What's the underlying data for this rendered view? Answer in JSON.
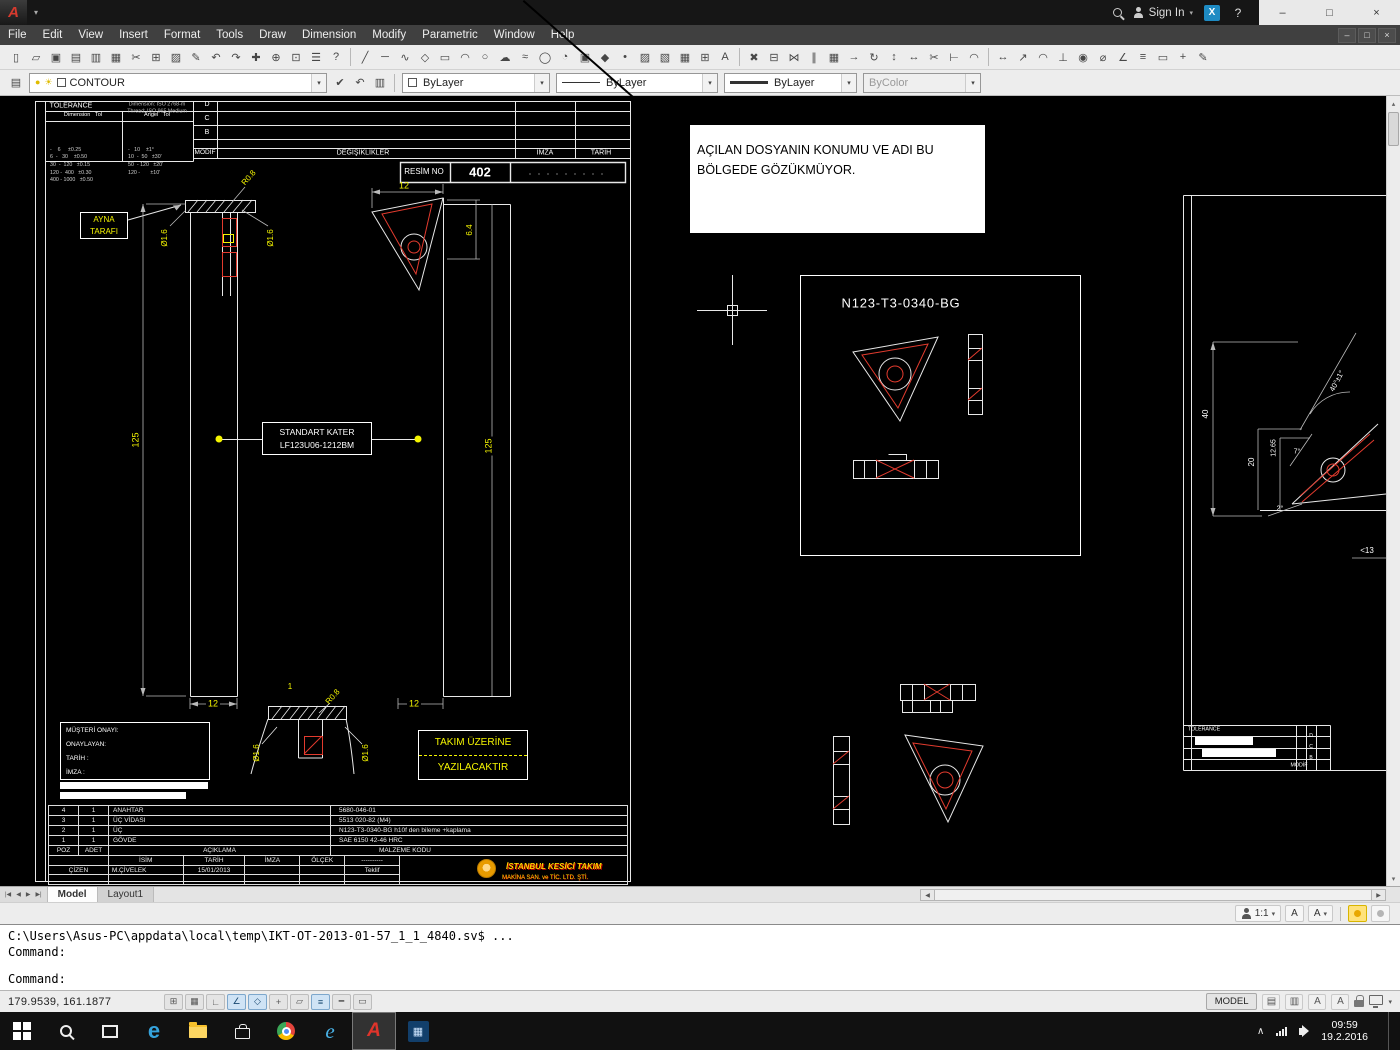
{
  "titlebar": {
    "sign_in": "Sign In",
    "menus": [
      "File",
      "Edit",
      "View",
      "Insert",
      "Format",
      "Tools",
      "Draw",
      "Dimension",
      "Modify",
      "Parametric",
      "Window",
      "Help"
    ]
  },
  "icons": {
    "minimize": "–",
    "maximize": "□",
    "close": "×",
    "caret_down": "▾",
    "caret_up": "▴",
    "chevron_up": "∧",
    "left": "◀",
    "right": "▶",
    "first": "|◀",
    "last": "▶|",
    "help": "?",
    "exchange": "X"
  },
  "toolbars": {
    "standard": [
      {
        "name": "qnew-icon",
        "g": "▯"
      },
      {
        "name": "open-icon",
        "g": "▱"
      },
      {
        "name": "save-icon",
        "g": "▣"
      },
      {
        "name": "plot-icon",
        "g": "▤"
      },
      {
        "name": "plot-preview-icon",
        "g": "▥"
      },
      {
        "name": "publish-icon",
        "g": "▦"
      },
      {
        "name": "cut-icon",
        "g": "✂"
      },
      {
        "name": "copy-icon",
        "g": "⊞"
      },
      {
        "name": "paste-icon",
        "g": "▨"
      },
      {
        "name": "match-properties-icon",
        "g": "✎"
      },
      {
        "name": "undo-icon",
        "g": "↶"
      },
      {
        "name": "redo-icon",
        "g": "↷"
      },
      {
        "name": "pan-icon",
        "g": "✚"
      },
      {
        "name": "zoom-realtime-icon",
        "g": "⊕"
      },
      {
        "name": "zoom-window-icon",
        "g": "⊡"
      },
      {
        "name": "properties-icon",
        "g": "☰"
      },
      {
        "name": "help-icon",
        "g": "?"
      }
    ],
    "draw": [
      {
        "name": "line-icon",
        "g": "╱"
      },
      {
        "name": "construction-line-icon",
        "g": "─"
      },
      {
        "name": "polyline-icon",
        "g": "∿"
      },
      {
        "name": "polygon-icon",
        "g": "◇"
      },
      {
        "name": "rectangle-icon",
        "g": "▭"
      },
      {
        "name": "arc-icon",
        "g": "◠"
      },
      {
        "name": "circle-icon",
        "g": "○"
      },
      {
        "name": "revcloud-icon",
        "g": "☁"
      },
      {
        "name": "spline-icon",
        "g": "≈"
      },
      {
        "name": "ellipse-icon",
        "g": "◯"
      },
      {
        "name": "ellipse-arc-icon",
        "g": "◔"
      },
      {
        "name": "insert-block-icon",
        "g": "▣"
      },
      {
        "name": "make-block-icon",
        "g": "◆"
      },
      {
        "name": "point-icon",
        "g": "•"
      },
      {
        "name": "hatch-icon",
        "g": "▨"
      },
      {
        "name": "gradient-icon",
        "g": "▧"
      },
      {
        "name": "region-icon",
        "g": "▦"
      },
      {
        "name": "table-icon",
        "g": "⊞"
      },
      {
        "name": "mtext-icon",
        "g": "A"
      }
    ],
    "modify": [
      {
        "name": "erase-icon",
        "g": "✖"
      },
      {
        "name": "copy-object-icon",
        "g": "⊟"
      },
      {
        "name": "mirror-icon",
        "g": "⋈"
      },
      {
        "name": "offset-icon",
        "g": "∥"
      },
      {
        "name": "array-icon",
        "g": "▦"
      },
      {
        "name": "move-icon",
        "g": "→"
      },
      {
        "name": "rotate-icon",
        "g": "↻"
      },
      {
        "name": "scale-icon",
        "g": "↕"
      },
      {
        "name": "stretch-icon",
        "g": "↔"
      },
      {
        "name": "trim-icon",
        "g": "✂"
      },
      {
        "name": "extend-icon",
        "g": "⊢"
      },
      {
        "name": "fillet-icon",
        "g": "◠"
      }
    ],
    "dimension": [
      {
        "name": "dim-linear-icon",
        "g": "↔"
      },
      {
        "name": "dim-aligned-icon",
        "g": "↗"
      },
      {
        "name": "dim-arc-icon",
        "g": "◠"
      },
      {
        "name": "dim-ordinate-icon",
        "g": "⊥"
      },
      {
        "name": "dim-radius-icon",
        "g": "◉"
      },
      {
        "name": "dim-diameter-icon",
        "g": "⌀"
      },
      {
        "name": "dim-angular-icon",
        "g": "∠"
      },
      {
        "name": "dim-quick-icon",
        "g": "≡"
      },
      {
        "name": "dim-baseline-icon",
        "g": "▭"
      },
      {
        "name": "dim-continue-icon",
        "g": "+"
      },
      {
        "name": "dim-style-icon",
        "g": "✎"
      }
    ]
  },
  "layers": {
    "current": "CONTOUR",
    "color": "ByLayer",
    "linetype": "ByLayer",
    "lineweight": "ByLayer",
    "plot_style": "ByColor"
  },
  "drawing": {
    "note": {
      "line1": "AÇILAN DOSYANIN KONUMU VE ADI BU",
      "line2": "BÖLGEDE GÖZÜKMÜYOR."
    },
    "insert_title": "N123-T3-0340-BG",
    "ayna": {
      "line1": "AYNA",
      "line2": "TARAFI"
    },
    "resim": {
      "label": "RESİM NO",
      "value": "402",
      "dots": ". . . . . . . . ."
    },
    "rev": {
      "letters": [
        "D",
        "C",
        "B"
      ],
      "modif": "MODİF",
      "degisiklikler": "DEĞİŞİKLİKLER",
      "imza": "İMZA",
      "tarih": "TARİH"
    },
    "tolerance": {
      "title": "TOLERANCE",
      "sub1": "Dimension: ISO 2768-m",
      "sub2": "Thread: ISO 965 Medium",
      "dim_header": "Dimension   Tol",
      "angle_header": "Angel   Tol",
      "dim_rows": [
        "-    6     ±0.25",
        "6  -   30    ±0.50",
        "30  -  120   ±0.15",
        "120 -  400   ±0.30",
        "400 - 1000   ±0.50"
      ],
      "angle_rows": [
        "-   10    ±1°",
        "10  -  50   ±30'",
        "50  - 120   ±20'",
        "120 -       ±10'"
      ]
    },
    "dims": {
      "d125": "125",
      "d12": "12",
      "d64": "6.4",
      "r08": "R0.8",
      "dia": "Ø1.6",
      "d1": "1"
    },
    "standart": {
      "line1": "STANDART KATER",
      "line2": "LF123U06-1212BM"
    },
    "takim": {
      "line1": "TAKIM ÜZERİNE",
      "line2": "YAZILACAKTIR"
    },
    "musteri": {
      "title": "MÜŞTERİ ONAYI:",
      "l1": "ONAYLAYAN:",
      "l2": "TARİH :",
      "l3": "İMZA :"
    },
    "parts": {
      "rows": [
        {
          "poz": "4",
          "adet": "1",
          "aciklama": "ANAHTAR",
          "kod": "5680-046-01"
        },
        {
          "poz": "3",
          "adet": "1",
          "aciklama": "ÜÇ VİDASI",
          "kod": "5513 020-82 (M4)"
        },
        {
          "poz": "2",
          "adet": "1",
          "aciklama": "ÜÇ",
          "kod": "N123-T3-0340-BG h10f den bileme +kaplama"
        },
        {
          "poz": "1",
          "adet": "1",
          "aciklama": "GÖVDE",
          "kod": "SAE 6150    42-46 HRC"
        }
      ],
      "footer": {
        "poz": "POZ",
        "adet": "ADET",
        "aciklama": "AÇIKLAMA",
        "kod": "MALZEME KODU"
      }
    },
    "titleblock": {
      "isim": "İSİM",
      "tarih": "TARİH",
      "imza": "İMZA",
      "olcek": "ÖLÇEK",
      "dashes": "----------",
      "cizen": "ÇİZEN",
      "name": "M.ÇİVELEK",
      "date": "15/01/2013",
      "teklif": "Teklif",
      "company1": "İSTANBUL KESİCİ TAKIM",
      "company2": "MAKİNA SAN. ve TİC. LTD. ŞTİ."
    },
    "right_dims": {
      "d40": "40",
      "d20": "20",
      "d1265": "12.65",
      "a7": "7°",
      "a2": "2°",
      "a40": "40°±1°",
      "d13": "<13"
    },
    "right_tb": {
      "title": "TOLERANCE",
      "letters": [
        "D",
        "C",
        "B"
      ],
      "modif": "MODİF"
    }
  },
  "tabs": {
    "model": "Model",
    "layout": "Layout1"
  },
  "right_strip": {
    "scale": "1:1"
  },
  "command": {
    "line1": "C:\\Users\\Asus-PC\\appdata\\local\\temp\\IKT-OT-2013-01-57_1_1_4840.sv$ ...",
    "line2": "Command:",
    "prompt": "Command:"
  },
  "statusbar": {
    "coords": "179.9539, 161.1877",
    "model_label": "MODEL",
    "toggles": [
      {
        "name": "snap-toggle",
        "g": "⊞",
        "on": false
      },
      {
        "name": "grid-toggle",
        "g": "▦",
        "on": false
      },
      {
        "name": "ortho-toggle",
        "g": "∟",
        "on": false
      },
      {
        "name": "polar-toggle",
        "g": "∠",
        "on": true
      },
      {
        "name": "osnap-toggle",
        "g": "◇",
        "on": true
      },
      {
        "name": "otrack-toggle",
        "g": "+",
        "on": false
      },
      {
        "name": "ducs-toggle",
        "g": "▱",
        "on": false
      },
      {
        "name": "dyn-toggle",
        "g": "≡",
        "on": true
      },
      {
        "name": "lwt-toggle",
        "g": "━",
        "on": false
      },
      {
        "name": "qp-toggle",
        "g": "▭",
        "on": false
      }
    ]
  },
  "taskbar": {
    "time": "09:59",
    "date": "19.2.2016"
  }
}
